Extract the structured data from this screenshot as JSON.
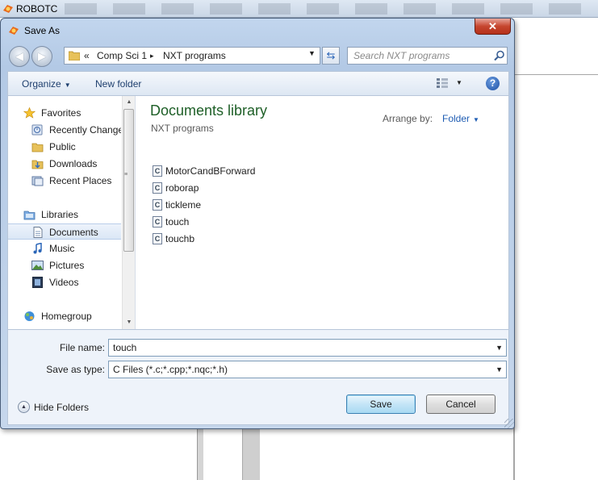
{
  "app": {
    "title": "ROBOTC"
  },
  "dialog": {
    "title": "Save As",
    "close_glyph": "✕"
  },
  "address": {
    "overflow": "«",
    "crumbs": [
      "Comp Sci 1",
      "NXT programs"
    ],
    "separator": "▸"
  },
  "search": {
    "placeholder": "Search NXT programs"
  },
  "toolbar": {
    "organize": "Organize",
    "new_folder": "New folder",
    "help": "?"
  },
  "nav": {
    "items": [
      {
        "label": "Favorites",
        "icon": "star-icon"
      },
      {
        "label": "Recently Changed",
        "icon": "recent-icon"
      },
      {
        "label": "Public",
        "icon": "folder-icon"
      },
      {
        "label": "Downloads",
        "icon": "downloads-icon"
      },
      {
        "label": "Recent Places",
        "icon": "recent-places-icon"
      },
      {
        "label": "Libraries",
        "icon": "libraries-icon"
      },
      {
        "label": "Documents",
        "icon": "documents-icon",
        "selected": true
      },
      {
        "label": "Music",
        "icon": "music-icon"
      },
      {
        "label": "Pictures",
        "icon": "pictures-icon"
      },
      {
        "label": "Videos",
        "icon": "videos-icon"
      },
      {
        "label": "Homegroup",
        "icon": "homegroup-icon"
      }
    ]
  },
  "files_pane": {
    "library_title": "Documents library",
    "library_subtitle": "NXT programs",
    "arrange_label": "Arrange by:",
    "arrange_value": "Folder",
    "files": [
      "MotorCandBForward",
      "roborap",
      "tickleme",
      "touch",
      "touchb"
    ],
    "file_icon_letter": "C"
  },
  "form": {
    "file_name_label": "File name:",
    "file_name_value": "touch",
    "save_type_label": "Save as type:",
    "save_type_value": "C Files (*.c;*.cpp;*.nqc;*.h)",
    "hide_folders": "Hide Folders",
    "save_button": "Save",
    "cancel_button": "Cancel"
  },
  "colors": {
    "library_title": "#1e5f27",
    "link_blue": "#1e5cb3",
    "close_red": "#c6462f"
  }
}
